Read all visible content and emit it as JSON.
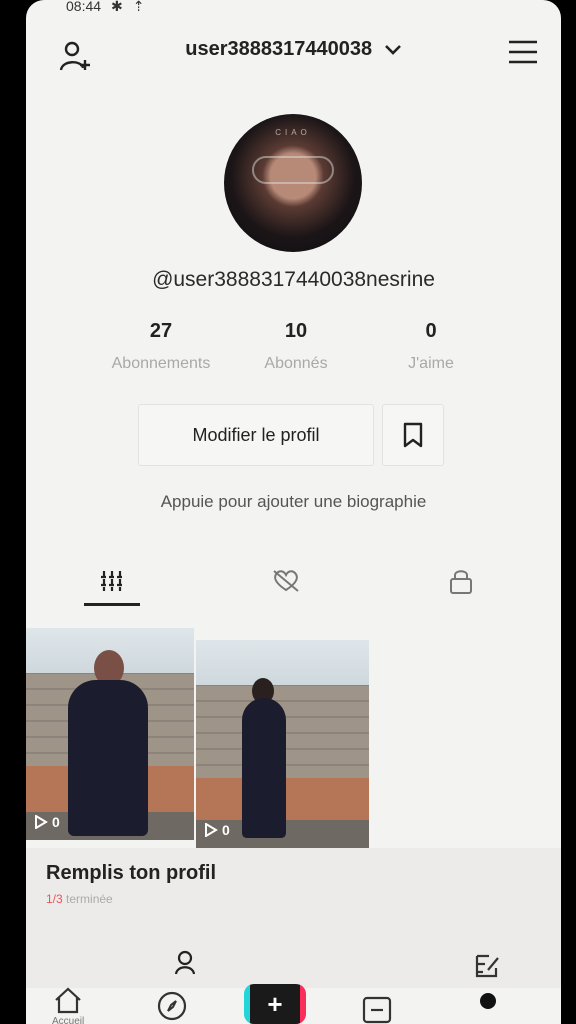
{
  "status_bar": {
    "time": "08:44"
  },
  "header": {
    "username": "user3888317440038"
  },
  "profile": {
    "handle": "@user3888317440038nesrine",
    "avatar_text": "CIAO",
    "stats": [
      {
        "count": "27",
        "label": "Abonnements"
      },
      {
        "count": "10",
        "label": "Abonnés"
      },
      {
        "count": "0",
        "label": "J'aime"
      }
    ],
    "edit_label": "Modifier le profil",
    "bio_placeholder": "Appuie pour ajouter une biographie"
  },
  "tabs": [
    {
      "icon": "grid-icon",
      "active": true
    },
    {
      "icon": "liked-hidden-icon",
      "active": false
    },
    {
      "icon": "lock-icon",
      "active": false
    }
  ],
  "videos": [
    {
      "views": "0"
    },
    {
      "views": "0"
    }
  ],
  "fill_profile": {
    "title": "Remplis ton profil",
    "progress": "1/3",
    "progress_suffix": "terminée"
  },
  "bottom_nav": [
    {
      "label": "Accueil",
      "icon": "home-icon"
    },
    {
      "label": "",
      "icon": "compass-icon"
    },
    {
      "label": "",
      "icon": "plus-icon"
    },
    {
      "label": "",
      "icon": "inbox-icon"
    },
    {
      "label": "",
      "icon": "profile-icon"
    }
  ],
  "colors": {
    "accent_red": "#fa2c58",
    "accent_cyan": "#23d5d9",
    "label_grey": "#a9a9a9"
  }
}
